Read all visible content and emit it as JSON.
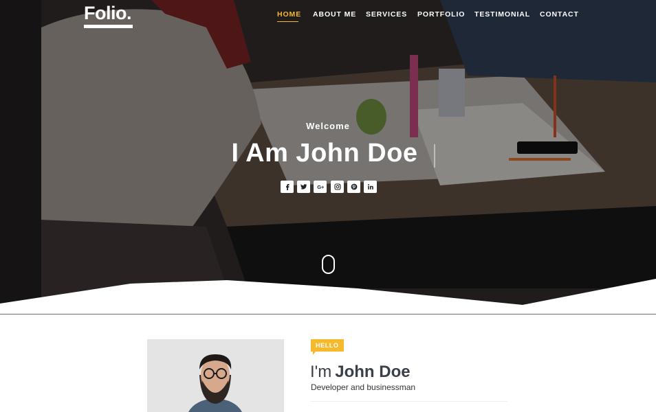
{
  "brand": {
    "logo_text": "Folio."
  },
  "nav": {
    "items": [
      {
        "label": "HOME",
        "active": true
      },
      {
        "label": "ABOUT ME",
        "active": false
      },
      {
        "label": "SERVICES",
        "active": false
      },
      {
        "label": "PORTFOLIO",
        "active": false
      },
      {
        "label": "TESTIMONIAL",
        "active": false
      },
      {
        "label": "CONTACT",
        "active": false
      }
    ]
  },
  "hero": {
    "welcome": "Welcome",
    "title": "I Am John Doe",
    "social_icons": [
      "facebook-icon",
      "twitter-icon",
      "google-plus-icon",
      "instagram-icon",
      "pinterest-icon",
      "linkedin-icon"
    ],
    "social_glyphs": [
      "f",
      "",
      "G+",
      "",
      "",
      "in"
    ]
  },
  "about": {
    "badge": "HELLO",
    "name_prefix": "I'm",
    "name": "John Doe",
    "role": "Developer and businessman"
  },
  "colors": {
    "accent": "#f6b92b",
    "text_dark": "#3a3f4a",
    "white": "#ffffff"
  }
}
